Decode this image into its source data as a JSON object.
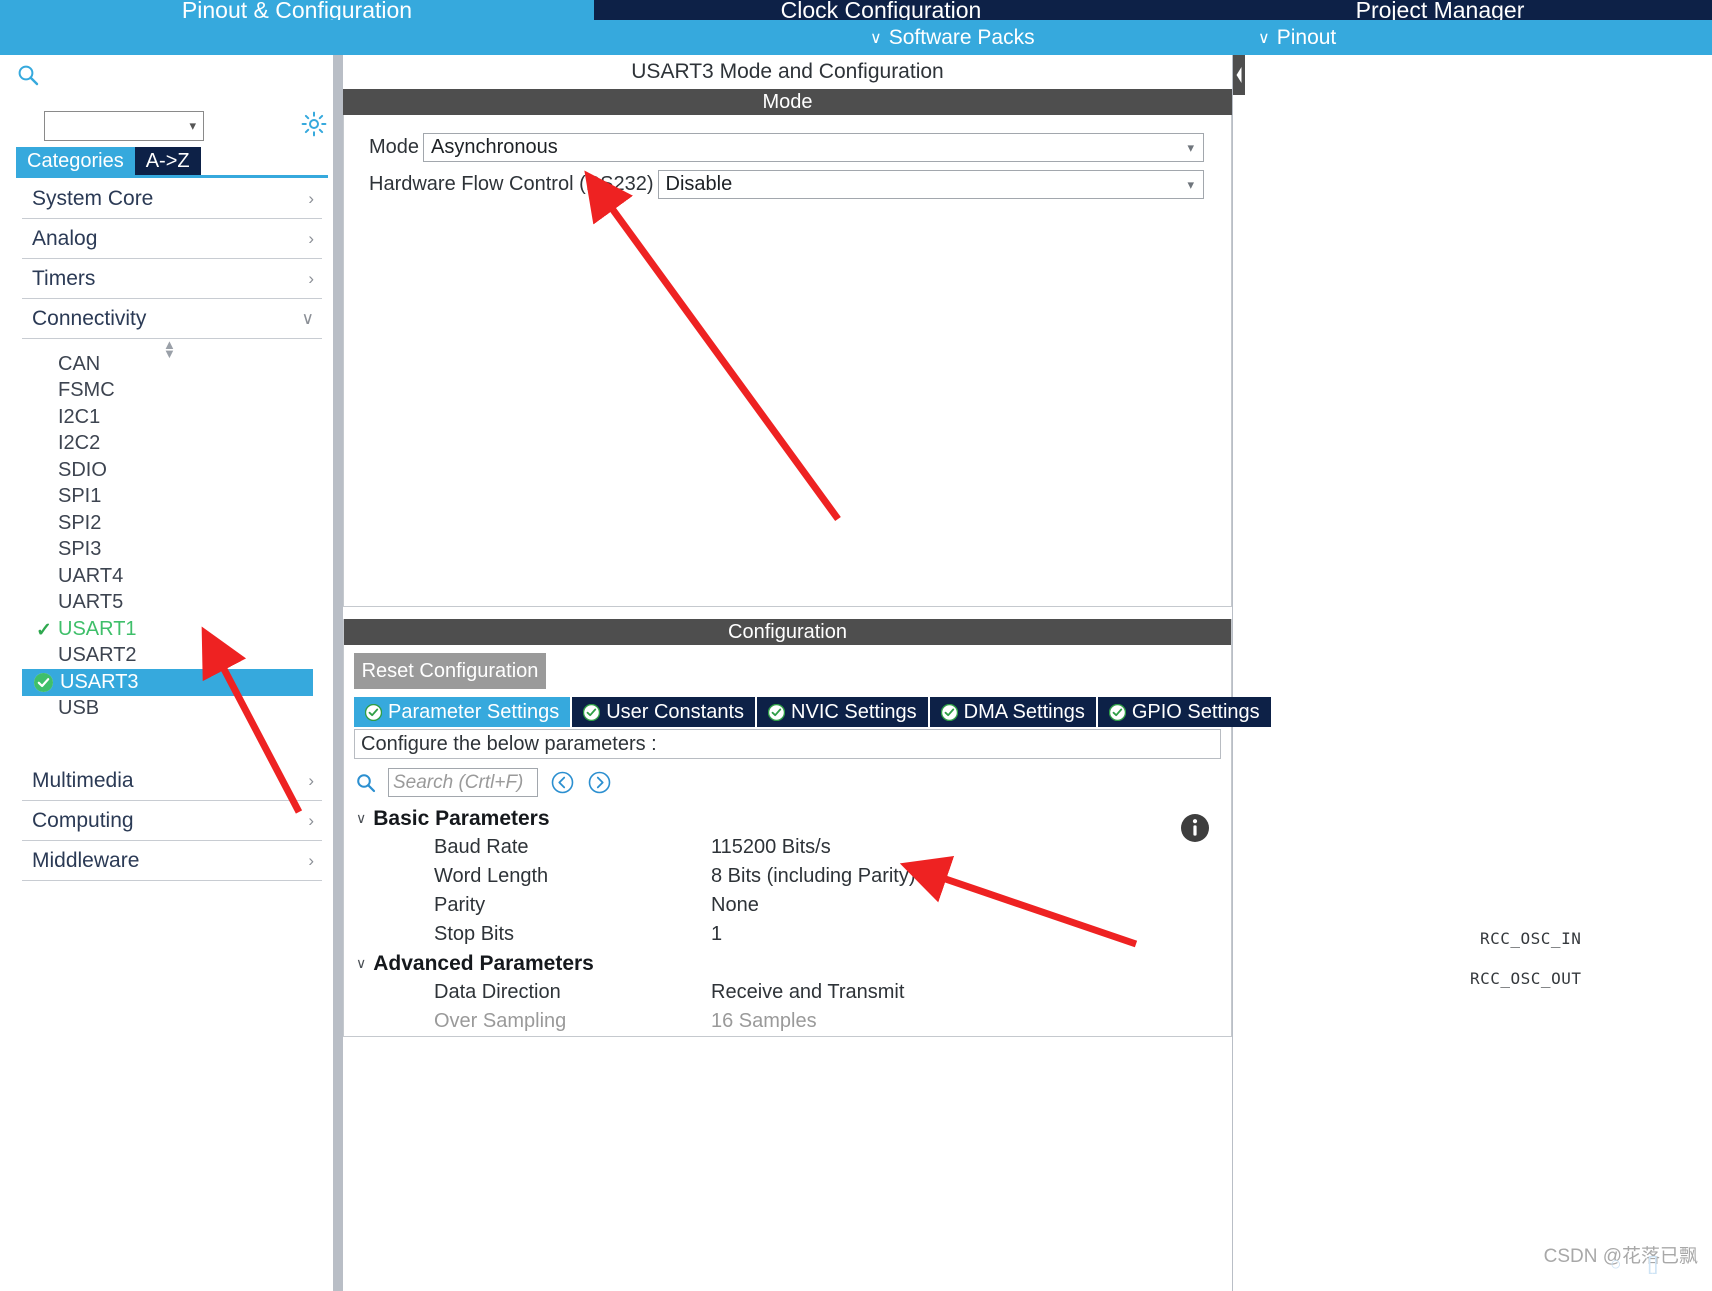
{
  "topbar": {
    "tabs": [
      {
        "label": "Pinout & Configuration",
        "state": "active"
      },
      {
        "label": "Clock Configuration",
        "state": "inactive"
      },
      {
        "label": "Project Manager",
        "state": "inactive"
      }
    ],
    "subitems": [
      {
        "label": "Software Packs",
        "chevron": "∨"
      },
      {
        "label": "Pinout",
        "chevron": "∨"
      }
    ]
  },
  "sidebar": {
    "search_placeholder": "",
    "icons": {
      "search": "search-icon",
      "gear": "gear-icon"
    },
    "category_tabs": [
      {
        "label": "Categories",
        "selected": true
      },
      {
        "label": "A->Z",
        "selected": false
      }
    ],
    "groups_top": [
      {
        "label": "System Core",
        "arrow": "›",
        "expanded": false
      },
      {
        "label": "Analog",
        "arrow": "›",
        "expanded": false
      },
      {
        "label": "Timers",
        "arrow": "›",
        "expanded": false
      },
      {
        "label": "Connectivity",
        "arrow": "∨",
        "expanded": true
      }
    ],
    "peripherals": [
      {
        "label": "CAN",
        "state": "normal"
      },
      {
        "label": "FSMC",
        "state": "normal"
      },
      {
        "label": "I2C1",
        "state": "normal"
      },
      {
        "label": "I2C2",
        "state": "normal"
      },
      {
        "label": "SDIO",
        "state": "normal"
      },
      {
        "label": "SPI1",
        "state": "normal"
      },
      {
        "label": "SPI2",
        "state": "normal"
      },
      {
        "label": "SPI3",
        "state": "normal"
      },
      {
        "label": "UART4",
        "state": "normal"
      },
      {
        "label": "UART5",
        "state": "normal"
      },
      {
        "label": "USART1",
        "state": "checked"
      },
      {
        "label": "USART2",
        "state": "normal"
      },
      {
        "label": "USART3",
        "state": "selected"
      },
      {
        "label": "USB",
        "state": "normal"
      }
    ],
    "groups_bottom": [
      {
        "label": "Multimedia",
        "arrow": "›"
      },
      {
        "label": "Computing",
        "arrow": "›"
      },
      {
        "label": "Middleware",
        "arrow": "›"
      }
    ]
  },
  "main": {
    "panel_title": "USART3 Mode and Configuration",
    "mode_header": "Mode",
    "mode_fields": [
      {
        "label": "Mode",
        "value": "Asynchronous"
      },
      {
        "label": "Hardware Flow Control (RS232)",
        "value": "Disable"
      }
    ],
    "config_header": "Configuration",
    "reset_label": "Reset Configuration",
    "config_tabs": [
      {
        "label": "Parameter Settings",
        "active": true
      },
      {
        "label": "User Constants",
        "active": false
      },
      {
        "label": "NVIC Settings",
        "active": false
      },
      {
        "label": "DMA Settings",
        "active": false
      },
      {
        "label": "GPIO Settings",
        "active": false
      }
    ],
    "config_note": "Configure the below parameters :",
    "param_search_placeholder": "Search (Crtl+F)",
    "param_groups": [
      {
        "label": "Basic Parameters",
        "chevron": "∨",
        "rows": [
          {
            "name": "Baud Rate",
            "value": "115200 Bits/s",
            "disabled": false
          },
          {
            "name": "Word Length",
            "value": "8 Bits (including Parity)",
            "disabled": false
          },
          {
            "name": "Parity",
            "value": "None",
            "disabled": false
          },
          {
            "name": "Stop Bits",
            "value": "1",
            "disabled": false
          }
        ]
      },
      {
        "label": "Advanced Parameters",
        "chevron": "∨",
        "rows": [
          {
            "name": "Data Direction",
            "value": "Receive and Transmit",
            "disabled": false
          },
          {
            "name": "Over Sampling",
            "value": "16 Samples",
            "disabled": true
          }
        ]
      }
    ]
  },
  "chip_labels": [
    {
      "text": "RCC_OSC_IN"
    },
    {
      "text": "RCC_OSC_OUT"
    }
  ],
  "watermark": {
    "text": "CSDN @花落已飘"
  },
  "colors": {
    "accent_blue": "#36a9dd",
    "dark_navy": "#0d2147",
    "header_grey": "#4e4e4e",
    "check_green": "#3fbf6a",
    "annotation_red": "#ee2222"
  }
}
